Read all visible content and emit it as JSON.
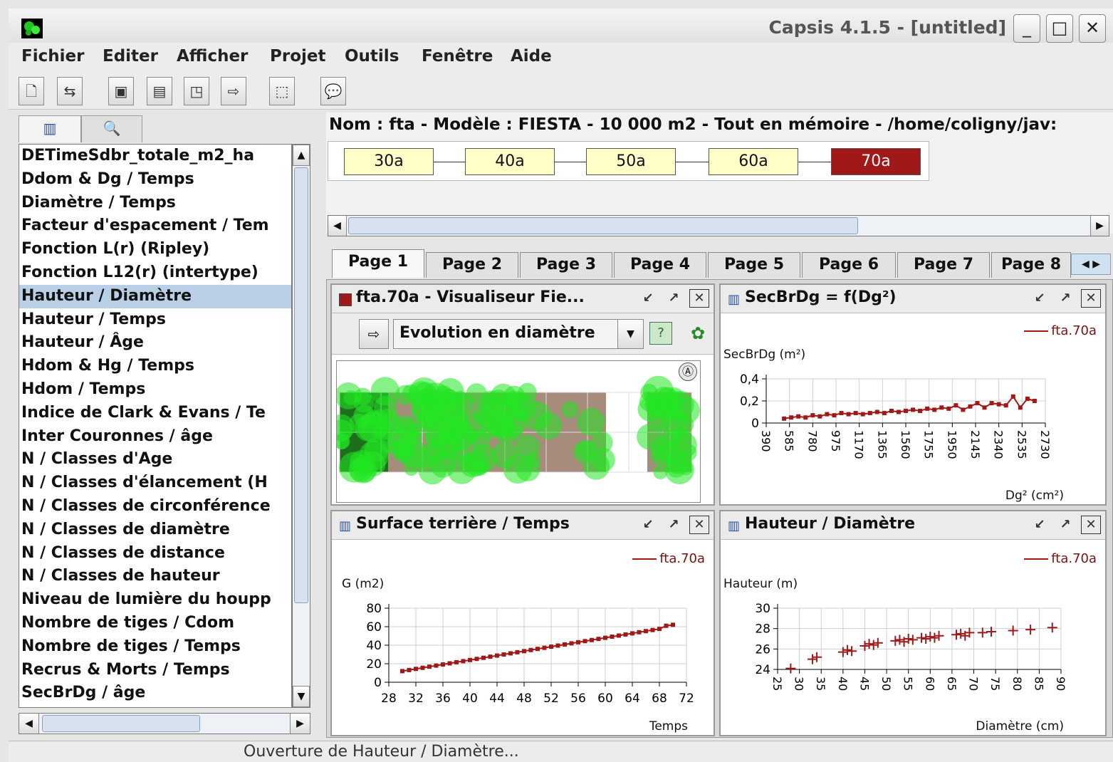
{
  "window": {
    "title": "Capsis 4.1.5 - [untitled]",
    "min": "_",
    "max": "□",
    "close": "✕"
  },
  "menu": [
    "Fichier",
    "Editer",
    "Afficher",
    "Projet",
    "Outils",
    "Fenêtre",
    "Aide"
  ],
  "toolbar": {
    "icons": [
      "new-project-icon",
      "open-project-icon",
      "save-icon",
      "save-as-icon",
      "close-project-icon",
      "export-icon",
      "selection-icon",
      "help-bubble-icon"
    ]
  },
  "left_panel": {
    "tabs": [
      "chart-icon",
      "search-icon"
    ],
    "items": [
      "DETimeSdbr_totale_m2_ha",
      "Ddom & Dg / Temps",
      "Diamètre / Temps",
      "Facteur d'espacement / Tem",
      "Fonction L(r) (Ripley)",
      "Fonction L12(r) (intertype)",
      "Hauteur / Diamètre",
      "Hauteur / Temps",
      "Hauteur / Âge",
      "Hdom & Hg / Temps",
      "Hdom / Temps",
      "Indice de Clark & Evans / Te",
      "Inter Couronnes / âge",
      "N / Classes d'Age",
      "N / Classes d'élancement (H",
      "N / Classes de circonférence",
      "N / Classes de diamètre",
      "N / Classes de distance",
      "N / Classes de hauteur",
      "Niveau de lumière du houpp",
      "Nombre de tiges / Cdom",
      "Nombre de tiges / Temps",
      "Recrus & Morts / Temps",
      "SecBrDg / âge"
    ],
    "selected_index": 6
  },
  "project": {
    "info": "Nom : fta - Modèle : FIESTA - 10 000 m2 - Tout en mémoire - /home/coligny/jav:",
    "steps": [
      "30a",
      "40a",
      "50a",
      "60a",
      "70a"
    ],
    "selected_step": "70a"
  },
  "tabs": [
    "Page 1",
    "Page 2",
    "Page 3",
    "Page 4",
    "Page 5",
    "Page 6",
    "Page 7",
    "Page 8"
  ],
  "active_tab": "Page 1",
  "frames": {
    "viewer": {
      "title": "fta.70a - Visualiseur Fie...",
      "dropdown_value": "Evolution en diamètre",
      "compass": "Ⓐ"
    },
    "secbrdg": {
      "title": "SecBrDg = f(Dg²)",
      "legend": "fta.70a",
      "ylabel": "SecBrDg (m²)",
      "xlabel": "Dg² (cm²)"
    },
    "surface": {
      "title": "Surface terrière / Temps",
      "legend": "fta.70a",
      "ylabel": "G (m2)",
      "xlabel": "Temps"
    },
    "hauteur": {
      "title": "Hauteur / Diamètre",
      "legend": "fta.70a",
      "ylabel": "Hauteur (m)",
      "xlabel": "Diamètre (cm)"
    }
  },
  "chart_data": [
    {
      "id": "secbrdg",
      "type": "line",
      "title": "SecBrDg = f(Dg²)",
      "xlabel": "Dg² (cm²)",
      "ylabel": "SecBrDg (m²)",
      "xlim": [
        390,
        2730
      ],
      "ylim": [
        0,
        0.4
      ],
      "xticks": [
        390,
        585,
        780,
        975,
        1170,
        1365,
        1560,
        1755,
        1950,
        2145,
        2340,
        2535,
        2730
      ],
      "yticks": [
        "0",
        "0,2",
        "0,4"
      ],
      "yticks_values": [
        0,
        0.2,
        0.4
      ],
      "series": [
        {
          "name": "fta.70a",
          "color": "#a01818",
          "x": [
            540,
            600,
            660,
            720,
            780,
            840,
            900,
            960,
            1020,
            1080,
            1140,
            1200,
            1260,
            1320,
            1380,
            1440,
            1500,
            1560,
            1620,
            1680,
            1740,
            1800,
            1860,
            1920,
            1980,
            2040,
            2100,
            2160,
            2220,
            2280,
            2340,
            2400,
            2460,
            2520,
            2580,
            2640
          ],
          "y": [
            0.04,
            0.05,
            0.06,
            0.05,
            0.07,
            0.06,
            0.08,
            0.07,
            0.09,
            0.08,
            0.09,
            0.08,
            0.09,
            0.1,
            0.09,
            0.11,
            0.1,
            0.11,
            0.12,
            0.11,
            0.13,
            0.12,
            0.14,
            0.13,
            0.16,
            0.12,
            0.15,
            0.18,
            0.14,
            0.18,
            0.17,
            0.16,
            0.24,
            0.14,
            0.22,
            0.2
          ]
        }
      ]
    },
    {
      "id": "surface",
      "type": "line",
      "title": "Surface terrière / Temps",
      "xlabel": "Temps",
      "ylabel": "G (m2)",
      "xlim": [
        28,
        72
      ],
      "ylim": [
        0,
        80
      ],
      "xticks": [
        28,
        32,
        36,
        40,
        44,
        48,
        52,
        56,
        60,
        64,
        68,
        72
      ],
      "yticks": [
        0,
        20,
        40,
        60,
        80
      ],
      "series": [
        {
          "name": "fta.70a",
          "color": "#a01818",
          "x": [
            30,
            31,
            32,
            33,
            34,
            35,
            36,
            37,
            38,
            39,
            40,
            41,
            42,
            43,
            44,
            45,
            46,
            47,
            48,
            49,
            50,
            51,
            52,
            53,
            54,
            55,
            56,
            57,
            58,
            59,
            60,
            61,
            62,
            63,
            64,
            65,
            66,
            67,
            68,
            69,
            70
          ],
          "y": [
            12,
            13.2,
            14.4,
            15.6,
            16.8,
            18,
            19.2,
            20.4,
            21.6,
            22.8,
            24,
            25.2,
            26.4,
            27.6,
            28.8,
            30,
            31.2,
            32.4,
            33.6,
            34.8,
            36,
            37.2,
            38.4,
            39.6,
            40.8,
            42,
            43.2,
            44.4,
            45.6,
            46.8,
            48,
            49.2,
            50.4,
            51.6,
            52.8,
            54,
            55.2,
            56.4,
            57.6,
            61,
            62
          ]
        }
      ]
    },
    {
      "id": "hauteur",
      "type": "scatter",
      "title": "Hauteur / Diamètre",
      "xlabel": "Diamètre (cm)",
      "ylabel": "Hauteur (m)",
      "xlim": [
        25,
        90
      ],
      "ylim": [
        24,
        30
      ],
      "xticks": [
        25,
        30,
        35,
        40,
        45,
        50,
        55,
        60,
        65,
        70,
        75,
        80,
        85,
        90
      ],
      "yticks": [
        24,
        26,
        28,
        30
      ],
      "series": [
        {
          "name": "fta.70a",
          "color": "#a01818",
          "marker": "+",
          "x": [
            28,
            33,
            34,
            40,
            41,
            42,
            45,
            46,
            47,
            48,
            52,
            53,
            54,
            55,
            56,
            58,
            59,
            60,
            61,
            62,
            66,
            67,
            68,
            69,
            72,
            74,
            79,
            83,
            88
          ],
          "y": [
            24.1,
            25,
            25.2,
            25.7,
            25.9,
            25.8,
            26.3,
            26.5,
            26.4,
            26.6,
            26.8,
            26.9,
            26.7,
            27,
            26.9,
            27.1,
            27.0,
            27.2,
            27.1,
            27.3,
            27.4,
            27.5,
            27.3,
            27.6,
            27.6,
            27.7,
            27.8,
            27.9,
            28.1
          ]
        }
      ]
    }
  ],
  "viewer_map": {
    "cell_color": "#a68c7a",
    "crown_color": "#22e622"
  },
  "status": "Ouverture de Hauteur / Diamètre..."
}
